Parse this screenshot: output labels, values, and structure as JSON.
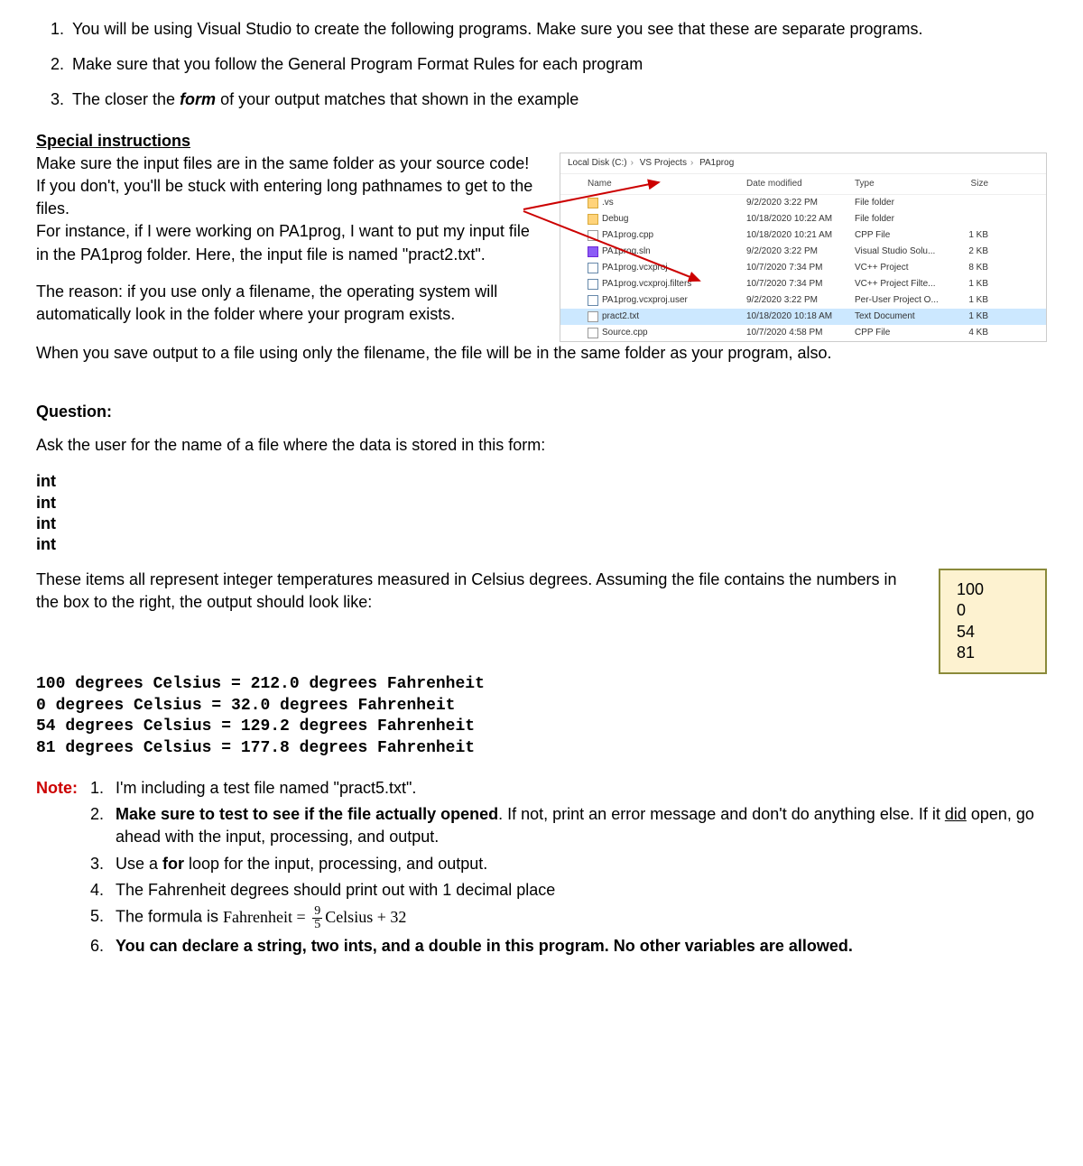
{
  "intro_list": [
    "You will be using Visual Studio to create the following programs. Make sure you see that these are separate programs.",
    "Make sure that you follow the General Program Format Rules for each program",
    "The closer the *form* of your output matches that shown in the example"
  ],
  "special": {
    "title": "Special instructions",
    "p1a": "Make sure the input files are in the same folder as your source code! If you don't, you'll be stuck with entering long pathnames to get to the files.",
    "p1b": "For instance, if I were working on PA1prog, I want to put my input file in the PA1prog folder. Here, the input file is named \"pract2.txt\".",
    "p2": "The reason: if you use only a filename, the operating system will automatically look in the folder where your program exists.",
    "p3": "When you save output to a file using only the filename, the file will be in the same folder as your program, also."
  },
  "explorer": {
    "breadcrumb": [
      "Local Disk (C:)",
      "VS Projects",
      "PA1prog"
    ],
    "headers": {
      "name": "Name",
      "date": "Date modified",
      "type": "Type",
      "size": "Size"
    },
    "rows": [
      {
        "icon": "folder",
        "name": ".vs",
        "date": "9/2/2020 3:22 PM",
        "type": "File folder",
        "size": "",
        "hl": false
      },
      {
        "icon": "folder",
        "name": "Debug",
        "date": "10/18/2020 10:22 AM",
        "type": "File folder",
        "size": "",
        "hl": false
      },
      {
        "icon": "file",
        "name": "PA1prog.cpp",
        "date": "10/18/2020 10:21 AM",
        "type": "CPP File",
        "size": "1 KB",
        "hl": false
      },
      {
        "icon": "sln",
        "name": "PA1prog.sln",
        "date": "9/2/2020 3:22 PM",
        "type": "Visual Studio Solu...",
        "size": "2 KB",
        "hl": false
      },
      {
        "icon": "proj",
        "name": "PA1prog.vcxproj",
        "date": "10/7/2020 7:34 PM",
        "type": "VC++ Project",
        "size": "8 KB",
        "hl": false
      },
      {
        "icon": "proj",
        "name": "PA1prog.vcxproj.filters",
        "date": "10/7/2020 7:34 PM",
        "type": "VC++ Project Filte...",
        "size": "1 KB",
        "hl": false
      },
      {
        "icon": "proj",
        "name": "PA1prog.vcxproj.user",
        "date": "9/2/2020 3:22 PM",
        "type": "Per-User Project O...",
        "size": "1 KB",
        "hl": false
      },
      {
        "icon": "file",
        "name": "pract2.txt",
        "date": "10/18/2020 10:18 AM",
        "type": "Text Document",
        "size": "1 KB",
        "hl": true
      },
      {
        "icon": "file",
        "name": "Source.cpp",
        "date": "10/7/2020 4:58 PM",
        "type": "CPP File",
        "size": "4 KB",
        "hl": false
      }
    ]
  },
  "question": {
    "title": "Question:",
    "prompt": "Ask the user for the name of a file where the data is stored in this form:",
    "types": [
      "int",
      "int",
      "int",
      "int"
    ],
    "desc": "These items all represent integer temperatures measured in Celsius degrees. Assuming the file contains the numbers in the box to the right, the output should look like:",
    "sample": [
      "100",
      "0",
      "54",
      "81"
    ],
    "output": [
      "100 degrees Celsius = 212.0 degrees Fahrenheit",
      "0 degrees Celsius = 32.0 degrees Fahrenheit",
      "54 degrees Celsius = 129.2 degrees Fahrenheit",
      "81 degrees Celsius = 177.8 degrees Fahrenheit"
    ]
  },
  "note": {
    "label": "Note:",
    "items": [
      {
        "plain": "I'm including a test file named \"pract5.txt\"."
      },
      {
        "html": "<span class='bold'>Make sure to test to see if the file actually opened</span>. If not, print an error message and don't do anything else. If it <span class='underline'>did</span> open, go ahead with the input, processing, and output."
      },
      {
        "html": "Use a <span class='bold'>for</span> loop for the input, processing, and output."
      },
      {
        "plain": "The Fahrenheit degrees should print out with 1 decimal place"
      },
      {
        "formula": true,
        "prefix": "The formula is ",
        "lhs": "Fahrenheit = ",
        "num": "9",
        "den": "5",
        "suffix": "Celsius + 32"
      },
      {
        "html": "<span class='bold'>You can declare a string, two ints, and a double in this program. No other variables are allowed.</span>"
      }
    ]
  }
}
